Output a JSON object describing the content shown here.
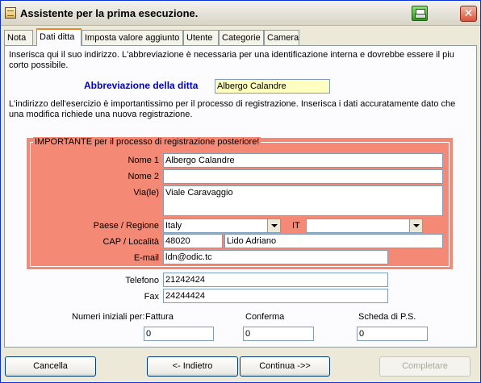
{
  "window": {
    "title": "Assistente per la prima esecuzione."
  },
  "tabs": [
    "Nota",
    "Dati ditta",
    "Imposta valore aggiunto",
    "Utente",
    "Categorie",
    "Camera"
  ],
  "intro_text": "Inserisca qui il suo indirizzo. L'abbreviazione è necessaria per una identificazione interna e dovrebbe essere il piu corto possibile.",
  "abbrev": {
    "label": "Abbreviazione della ditta",
    "value": "Albergo Calandre"
  },
  "address_text": "L'indirizzo dell'esercizio è importantissimo per il processo di registrazione. Inserisca i dati accuratamente dato che una modifica richiede una nuova registrazione.",
  "important_legend": "IMPORTANTE per il processo di registrazione posteriore!",
  "fields": {
    "nome1": {
      "label": "Nome 1",
      "value": "Albergo Calandre"
    },
    "nome2": {
      "label": "Nome 2",
      "value": ""
    },
    "via": {
      "label": "Via(le)",
      "value": "Viale Caravaggio"
    },
    "paese": {
      "label": "Paese / Regione",
      "value": "Italy",
      "code": "IT",
      "region": ""
    },
    "cap": {
      "label": "CAP / Località",
      "cap": "48020",
      "localita": "Lido Adriano"
    },
    "email": {
      "label": "E-mail",
      "value": "ldn@odic.tc"
    },
    "telefono": {
      "label": "Telefono",
      "value": "21242424"
    },
    "fax": {
      "label": "Fax",
      "value": "24244424"
    }
  },
  "initial_numbers": {
    "label": "Numeri iniziali per:",
    "fattura": {
      "label": "Fattura",
      "value": "0"
    },
    "conferma": {
      "label": "Conferma",
      "value": "0"
    },
    "scheda": {
      "label": "Scheda di P.S.",
      "value": "0"
    }
  },
  "buttons": {
    "cancel": "Cancella",
    "back": "<- Indietro",
    "next": "Continua ->>",
    "finish": "Completare"
  },
  "colors": {
    "important_bg": "#F48975",
    "abbrev_label": "#0000C0",
    "abbrev_field_bg": "#FFFFC0",
    "active_tab_accent": "#E68B2C"
  },
  "icons": [
    "app-icon",
    "printer-icon",
    "close-icon",
    "dropdown-arrow-icon"
  ]
}
